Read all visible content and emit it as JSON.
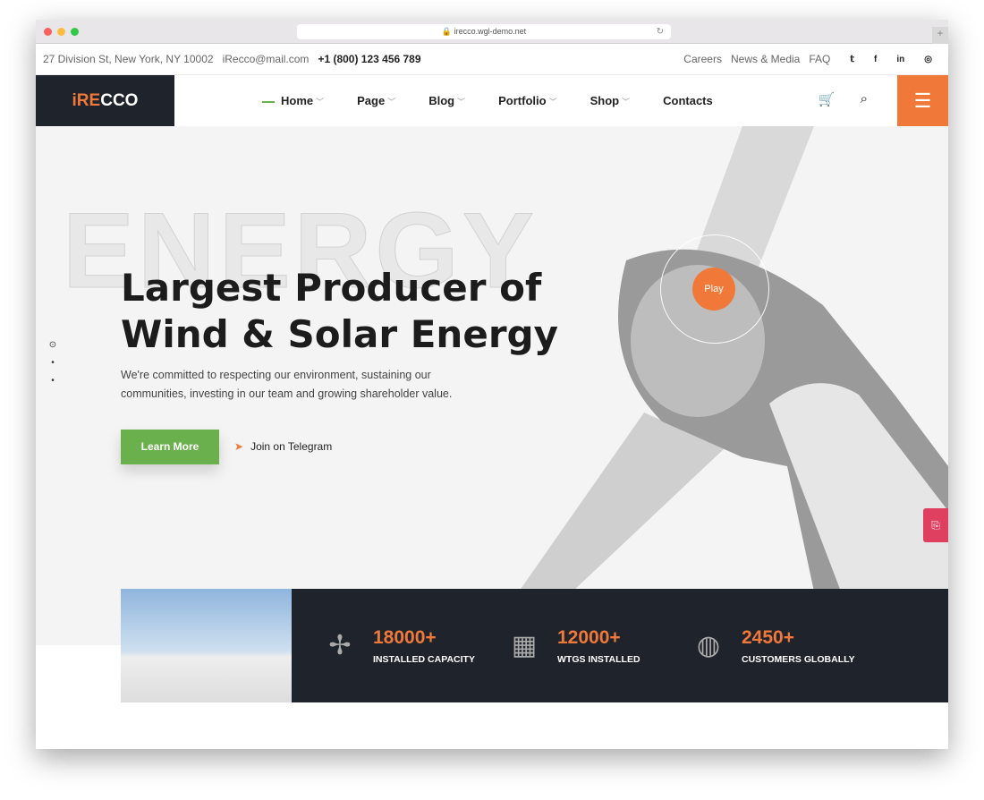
{
  "browser": {
    "url": "irecco.wgl-demo.net"
  },
  "topbar": {
    "address": "27 Division St, New York, NY 10002",
    "email": "iRecco@mail.com",
    "phone": "+1 (800) 123 456 789",
    "links": [
      "Careers",
      "News & Media",
      "FAQ"
    ],
    "social": [
      "twitter",
      "facebook",
      "linkedin",
      "instagram"
    ]
  },
  "logo": {
    "prefix": "iRE",
    "suffix": "CCO"
  },
  "nav": {
    "items": [
      "Home",
      "Page",
      "Blog",
      "Portfolio",
      "Shop",
      "Contacts"
    ]
  },
  "hero": {
    "bg_word": "ENERGY",
    "title_line1": "Largest Producer of",
    "title_line2": "Wind & Solar Energy",
    "subtitle": "We're committed to respecting our environment, sustaining our communities, investing in our team and growing shareholder value.",
    "cta": "Learn More",
    "telegram": "Join on Telegram",
    "play": "Play"
  },
  "stats": [
    {
      "value": "18000+",
      "label": "INSTALLED CAPACITY"
    },
    {
      "value": "12000+",
      "label": "WTGS INSTALLED"
    },
    {
      "value": "2450+",
      "label": "CUSTOMERS GLOBALLY"
    }
  ],
  "colors": {
    "accent": "#f0793a",
    "green": "#6ab04c",
    "dark": "#1f232b"
  }
}
